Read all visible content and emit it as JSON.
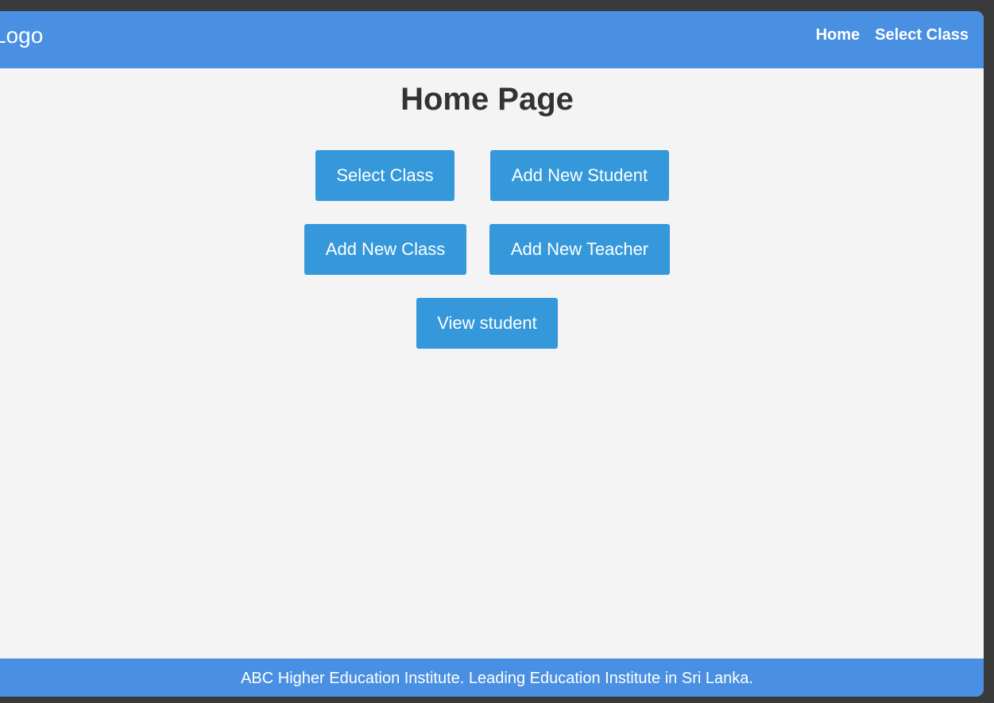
{
  "header": {
    "logo_text": "Logo",
    "nav": {
      "home": "Home",
      "select_class": "Select Class"
    }
  },
  "main": {
    "title": "Home Page",
    "buttons": {
      "select_class": "Select Class",
      "add_new_student": "Add New Student",
      "add_new_class": "Add New Class",
      "add_new_teacher": "Add New Teacher",
      "view_student": "View student"
    }
  },
  "footer": {
    "text": "ABC Higher Education Institute. Leading Education Institute in Sri Lanka."
  },
  "colors": {
    "header_bg": "#4a90e2",
    "button_bg": "#3498db",
    "page_bg": "#f4f4f5",
    "title_text": "#333333"
  }
}
